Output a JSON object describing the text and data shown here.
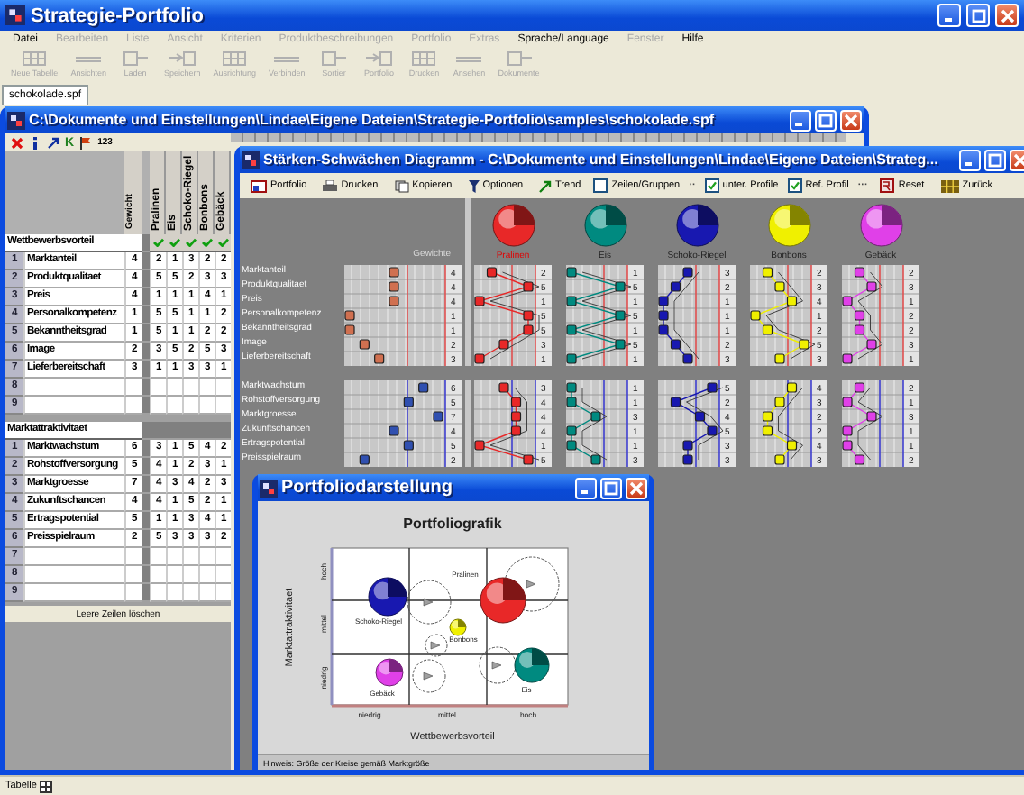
{
  "app": {
    "title": "Strategie-Portfolio",
    "status": "Tabelle"
  },
  "menu": [
    {
      "label": "Datei",
      "disabled": false
    },
    {
      "label": "Bearbeiten",
      "disabled": true
    },
    {
      "label": "Liste",
      "disabled": true
    },
    {
      "label": "Ansicht",
      "disabled": true
    },
    {
      "label": "Kriterien",
      "disabled": true
    },
    {
      "label": "Produktbeschreibungen",
      "disabled": true
    },
    {
      "label": "Portfolio",
      "disabled": true
    },
    {
      "label": "Extras",
      "disabled": true
    },
    {
      "label": "Sprache/Language",
      "disabled": false
    },
    {
      "label": "Fenster",
      "disabled": true
    },
    {
      "label": "Hilfe",
      "disabled": false
    }
  ],
  "toolbar": [
    {
      "label": "Neue Tabelle",
      "disabled": true
    },
    {
      "label": "Ansichten",
      "disabled": true
    },
    {
      "label": "Laden",
      "disabled": true
    },
    {
      "label": "Speichern",
      "disabled": true
    },
    {
      "label": "Ausrichtung",
      "disabled": true
    },
    {
      "label": "Verbinden",
      "disabled": true
    },
    {
      "label": "Sortier",
      "disabled": true
    },
    {
      "label": "Portfolio",
      "disabled": true
    },
    {
      "label": "Drucken",
      "disabled": true
    },
    {
      "label": "Ansehen",
      "disabled": true
    },
    {
      "label": "Dokumente",
      "disabled": true
    }
  ],
  "file_tabs": [
    {
      "label": "schokolade.spf",
      "selected": true
    }
  ],
  "table_window": {
    "title": "C:\\Dokumente und Einstellungen\\Lindae\\Eigene Dateien\\Strategie-Portfolio\\samples\\schokolade.spf",
    "tools": [
      {
        "kind": "delete"
      },
      {
        "kind": "info"
      },
      {
        "kind": "trend"
      },
      {
        "kind": "text",
        "label": "K"
      },
      {
        "kind": "flag"
      },
      {
        "kind": "text",
        "label": "123"
      }
    ],
    "weight_header": "Gewicht",
    "products": [
      {
        "name": "Pralinen",
        "checked": true
      },
      {
        "name": "Eis",
        "checked": true
      },
      {
        "name": "Schoko-Riegel",
        "checked": true
      },
      {
        "name": "Bonbons",
        "checked": true
      },
      {
        "name": "Gebäck",
        "checked": true
      }
    ],
    "groups": [
      {
        "title": "Wettbewerbsvorteil",
        "rows": [
          {
            "index": "1",
            "name": "Marktanteil",
            "weight": "4",
            "values": [
              "2",
              "1",
              "3",
              "2",
              "2"
            ]
          },
          {
            "index": "2",
            "name": "Produktqualitaet",
            "weight": "4",
            "values": [
              "5",
              "5",
              "2",
              "3",
              "3"
            ]
          },
          {
            "index": "3",
            "name": "Preis",
            "weight": "4",
            "values": [
              "1",
              "1",
              "1",
              "4",
              "1"
            ]
          },
          {
            "index": "4",
            "name": "Personalkompetenz",
            "weight": "1",
            "values": [
              "5",
              "5",
              "1",
              "1",
              "2"
            ]
          },
          {
            "index": "5",
            "name": "Bekanntheitsgrad",
            "weight": "1",
            "values": [
              "5",
              "1",
              "1",
              "2",
              "2"
            ]
          },
          {
            "index": "6",
            "name": "Image",
            "weight": "2",
            "values": [
              "3",
              "5",
              "2",
              "5",
              "3"
            ]
          },
          {
            "index": "7",
            "name": "Lieferbereitschaft",
            "weight": "3",
            "values": [
              "1",
              "1",
              "3",
              "3",
              "1"
            ]
          },
          {
            "index": "8"
          },
          {
            "index": "9"
          }
        ]
      },
      {
        "title": "Marktattraktivitaet",
        "rows": [
          {
            "index": "1",
            "name": "Marktwachstum",
            "weight": "6",
            "values": [
              "3",
              "1",
              "5",
              "4",
              "2"
            ]
          },
          {
            "index": "2",
            "name": "Rohstoffversorgung",
            "weight": "5",
            "values": [
              "4",
              "1",
              "2",
              "3",
              "1"
            ]
          },
          {
            "index": "3",
            "name": "Marktgroesse",
            "weight": "7",
            "values": [
              "4",
              "3",
              "4",
              "2",
              "3"
            ]
          },
          {
            "index": "4",
            "name": "Zukunftschancen",
            "weight": "4",
            "values": [
              "4",
              "1",
              "5",
              "2",
              "1"
            ]
          },
          {
            "index": "5",
            "name": "Ertragspotential",
            "weight": "5",
            "values": [
              "1",
              "1",
              "3",
              "4",
              "1"
            ]
          },
          {
            "index": "6",
            "name": "Preisspielraum",
            "weight": "2",
            "values": [
              "5",
              "3",
              "3",
              "3",
              "2"
            ]
          },
          {
            "index": "7"
          },
          {
            "index": "8"
          },
          {
            "index": "9"
          }
        ]
      }
    ],
    "footer": "Leere Zeilen löschen"
  },
  "profile_window": {
    "title": "Stärken-Schwächen Diagramm - C:\\Dokumente und Einstellungen\\Lindae\\Eigene Dateien\\Strateg...",
    "toolbar": [
      {
        "kind": "button",
        "label": "Portfolio"
      },
      {
        "kind": "button",
        "label": "Drucken"
      },
      {
        "kind": "button",
        "label": "Kopieren"
      },
      {
        "kind": "button",
        "label": "Optionen"
      },
      {
        "kind": "button",
        "label": "Trend"
      },
      {
        "kind": "checkbox",
        "label": "Zeilen/Gruppen",
        "checked": false
      },
      {
        "kind": "dots",
        "label": "··"
      },
      {
        "kind": "checkbox",
        "label": "unter. Profile",
        "checked": true
      },
      {
        "kind": "checkbox",
        "label": "Ref. Profil",
        "checked": true
      },
      {
        "kind": "dots",
        "label": "···"
      },
      {
        "kind": "button",
        "label": "Reset"
      },
      {
        "kind": "button",
        "label": "Zurück"
      }
    ],
    "weights_label": "Gewichte",
    "products": [
      {
        "name": "Pralinen",
        "color": "#e82828",
        "selected": true
      },
      {
        "name": "Eis",
        "color": "#008a80",
        "selected": false
      },
      {
        "name": "Schoko-Riegel",
        "color": "#1818b0",
        "selected": false
      },
      {
        "name": "Bonbons",
        "color": "#f0f000",
        "selected": false
      },
      {
        "name": "Gebäck",
        "color": "#e040e8",
        "selected": false
      }
    ],
    "groups": [
      {
        "rows": [
          {
            "label": "Marktanteil",
            "values": [
              "4",
              "2",
              "1",
              "3",
              "2",
              "2"
            ]
          },
          {
            "label": "Produktqualitaet",
            "values": [
              "4",
              "5",
              "5",
              "2",
              "3",
              "3"
            ]
          },
          {
            "label": "Preis",
            "values": [
              "4",
              "1",
              "1",
              "1",
              "4",
              "1"
            ]
          },
          {
            "label": "Personalkompetenz",
            "values": [
              "1",
              "5",
              "5",
              "1",
              "1",
              "2"
            ]
          },
          {
            "label": "Bekanntheitsgrad",
            "values": [
              "1",
              "5",
              "1",
              "1",
              "2",
              "2"
            ]
          },
          {
            "label": "Image",
            "values": [
              "2",
              "3",
              "5",
              "2",
              "5",
              "3"
            ]
          },
          {
            "label": "Lieferbereitschaft",
            "values": [
              "3",
              "1",
              "1",
              "3",
              "3",
              "1"
            ]
          }
        ]
      },
      {
        "rows": [
          {
            "label": "Marktwachstum",
            "values": [
              "6",
              "3",
              "1",
              "5",
              "4",
              "2"
            ]
          },
          {
            "label": "Rohstoffversorgung",
            "values": [
              "5",
              "4",
              "1",
              "2",
              "3",
              "1"
            ]
          },
          {
            "label": "Marktgroesse",
            "values": [
              "7",
              "4",
              "3",
              "4",
              "2",
              "3"
            ]
          },
          {
            "label": "Zukunftschancen",
            "values": [
              "4",
              "4",
              "1",
              "5",
              "2",
              "1"
            ]
          },
          {
            "label": "Ertragspotential",
            "values": [
              "5",
              "1",
              "1",
              "3",
              "4",
              "1"
            ]
          },
          {
            "label": "Preisspielraum",
            "values": [
              "2",
              "5",
              "3",
              "3",
              "3",
              "2"
            ]
          }
        ]
      }
    ]
  },
  "portfolio_window": {
    "title": "Portfoliodarstellung",
    "chart_title": "Portfoliografik",
    "xlabel": "Wettbewerbsvorteil",
    "ylabel": "Marktattraktivitaet",
    "xticks": [
      "niedrig",
      "mittel",
      "hoch"
    ],
    "yticks": [
      "niedrig",
      "mittel",
      "hoch"
    ],
    "bubbles": [
      {
        "label": "Pralinen",
        "color": "#e82828"
      },
      {
        "label": "Eis",
        "color": "#008a80"
      },
      {
        "label": "Schoko-Riegel",
        "color": "#1818b0"
      },
      {
        "label": "Bonbons",
        "color": "#f0f000"
      },
      {
        "label": "Gebäck",
        "color": "#e040e8"
      }
    ],
    "hint": "Hinweis: Größe der Kreise gemäß Marktgröße"
  }
}
